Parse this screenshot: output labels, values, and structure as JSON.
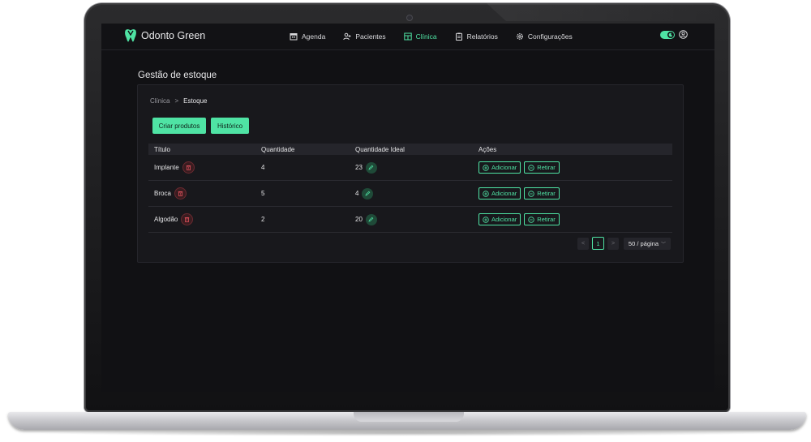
{
  "app": {
    "brand": "Odonto Green",
    "accent": "#4fe3a4"
  },
  "nav": [
    {
      "label": "Agenda",
      "icon": "calendar-icon",
      "active": false
    },
    {
      "label": "Pacientes",
      "icon": "users-icon",
      "active": false
    },
    {
      "label": "Clínica",
      "icon": "clinic-icon",
      "active": true
    },
    {
      "label": "Relatórios",
      "icon": "report-icon",
      "active": false
    },
    {
      "label": "Configurações",
      "icon": "gear-icon",
      "active": false
    }
  ],
  "page": {
    "title": "Gestão de estoque"
  },
  "breadcrumb": {
    "parent": "Clínica",
    "separator": ">",
    "current": "Estoque"
  },
  "toolbar": {
    "create_label": "Criar produtos",
    "history_label": "Histórico"
  },
  "table": {
    "headers": [
      "Título",
      "Quantidade",
      "Quantidade Ideal",
      "Ações"
    ],
    "rows": [
      {
        "title": "Implante",
        "quantity": "4",
        "ideal": "23"
      },
      {
        "title": "Broca",
        "quantity": "5",
        "ideal": "4"
      },
      {
        "title": "Algodão",
        "quantity": "2",
        "ideal": "20"
      }
    ],
    "add_label": "Adicionar",
    "remove_label": "Retirar"
  },
  "pagination": {
    "prev": "<",
    "current": "1",
    "next": ">",
    "page_size": "50 / página"
  }
}
